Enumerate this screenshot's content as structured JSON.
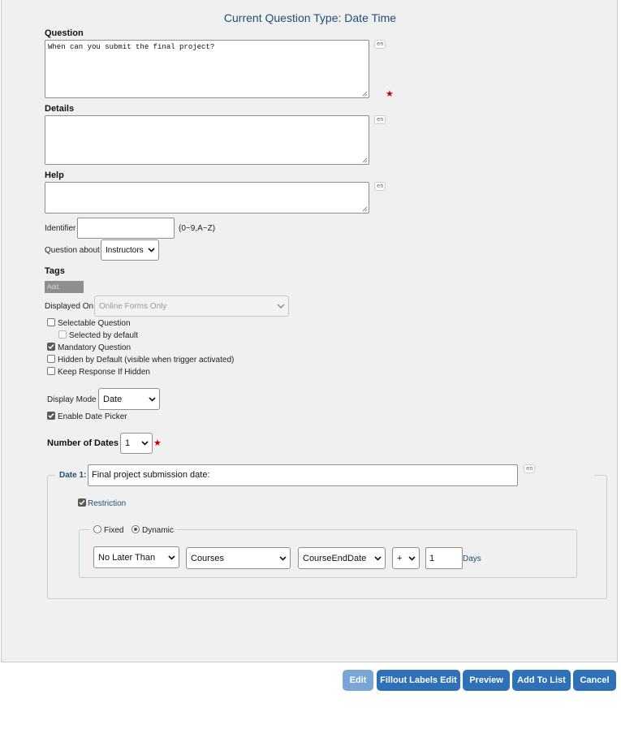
{
  "header": {
    "title": "Current Question Type: Date Time"
  },
  "question": {
    "label": "Question",
    "value": "When can you submit the final project?",
    "lang": "en",
    "required_mark": "★"
  },
  "details": {
    "label": "Details",
    "value": "",
    "lang": "en"
  },
  "help": {
    "label": "Help",
    "value": "",
    "lang": "en"
  },
  "identifier": {
    "label": "Identifier",
    "value": "",
    "hint": "(0~9,A~Z)"
  },
  "question_about": {
    "label": "Question about",
    "value": "Instructors"
  },
  "tags": {
    "label": "Tags",
    "add_placeholder": "Add."
  },
  "displayed_on": {
    "label": "Displayed On",
    "value": "Online Forms Only"
  },
  "options": {
    "selectable": {
      "label": "Selectable Question",
      "checked": false
    },
    "selected_default": {
      "label": "Selected by default",
      "checked": false
    },
    "mandatory": {
      "label": "Mandatory Question",
      "checked": true
    },
    "hidden_default": {
      "label": "Hidden by Default (visible when trigger activated)",
      "checked": false
    },
    "keep_response": {
      "label": "Keep Response If Hidden",
      "checked": false
    }
  },
  "display_mode": {
    "label": "Display Mode",
    "value": "Date"
  },
  "date_picker": {
    "label": "Enable Date Picker",
    "checked": true
  },
  "number_of_dates": {
    "label": "Number of Dates",
    "value": "1",
    "required_mark": "★"
  },
  "date1": {
    "legend": "Date 1:",
    "value": "Final project submission date:",
    "lang": "en",
    "restriction": {
      "label": "Restriction",
      "checked": true
    },
    "mode": {
      "fixed_label": "Fixed",
      "dynamic_label": "Dynamic",
      "selected": "Dynamic"
    },
    "rule": {
      "comparison": "No Later Than",
      "source": "Courses",
      "field": "CourseEndDate",
      "operator": "+",
      "amount": "1",
      "unit": "Days"
    }
  },
  "buttons": {
    "edit": "Edit",
    "fillout_labels_edit": "Fillout Labels Edit",
    "preview": "Preview",
    "add_to_list": "Add To List",
    "cancel": "Cancel"
  }
}
